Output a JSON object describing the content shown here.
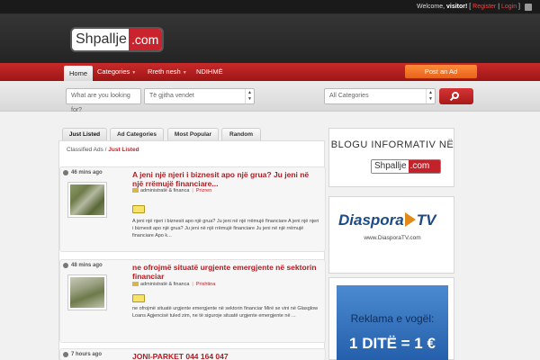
{
  "header": {
    "welcome_prefix": "Welcome, ",
    "visitor": "visitor!",
    "bar1": " [ ",
    "register": "Register",
    "bar2": " | ",
    "login": "Login",
    "bar3": " ]",
    "logo_part1": "Shpallje",
    "logo_part2": ".com"
  },
  "nav": {
    "items": [
      "Home",
      "Categories",
      "Rreth nesh",
      "NDIHMË"
    ],
    "post_ad": "Post an Ad"
  },
  "search": {
    "placeholder": "What are you looking for?",
    "location": "Të gjitha vendet",
    "category": "All Categories"
  },
  "tabs": [
    "Just Listed",
    "Ad Categories",
    "Most Popular",
    "Random"
  ],
  "breadcrumb": {
    "root": "Classified Ads",
    "sep": " / ",
    "current": "Just Listed"
  },
  "listings": [
    {
      "time": "46 mins ago",
      "title": "A jeni një njeri i biznesit apo një grua? Ju jeni në një rrëmujë financiare...",
      "category": "administratë & financa",
      "tag": "Prizren",
      "desc": "A jeni një njeri i biznesit apo një grua? Ju jeni në një rrëmujë financiare A jeni një njeri i biznesit apo një grua? Ju jeni në një rrëmujë financiare Ju jeni në një rrëmujë financiare Apo k..."
    },
    {
      "time": "48 mins ago",
      "title": "ne ofrojmë situatë urgjente emergjente në sektorin financiar",
      "category": "administratë & financa",
      "tag": "Prishtina",
      "desc": "ne ofrojmë situatë urgjente emergjente në sektorin financiar Mirë se vini në Glasglow Loans Agjencisë tuled zim, ne të siguroje situatë urgjente emergjente në ..."
    },
    {
      "time": "7 hours ago",
      "title": "JONI-PARKET 044 164 047"
    }
  ],
  "sidebar": {
    "ad1_title": "BLOGU INFORMATIV NË",
    "ad1_logo1": "Shpallje",
    "ad1_logo2": ".com",
    "ad2_title": "Diaspora",
    "ad2_tv": "TV",
    "ad2_url": "www.DiasporaTV.com",
    "ad3_line1": "Reklama e vogël:",
    "ad3_line2": "1 DITË = 1 €"
  },
  "colors": {
    "accent_red": "#c4222a",
    "orange": "#f07a26",
    "dark": "#2a2a2a"
  }
}
